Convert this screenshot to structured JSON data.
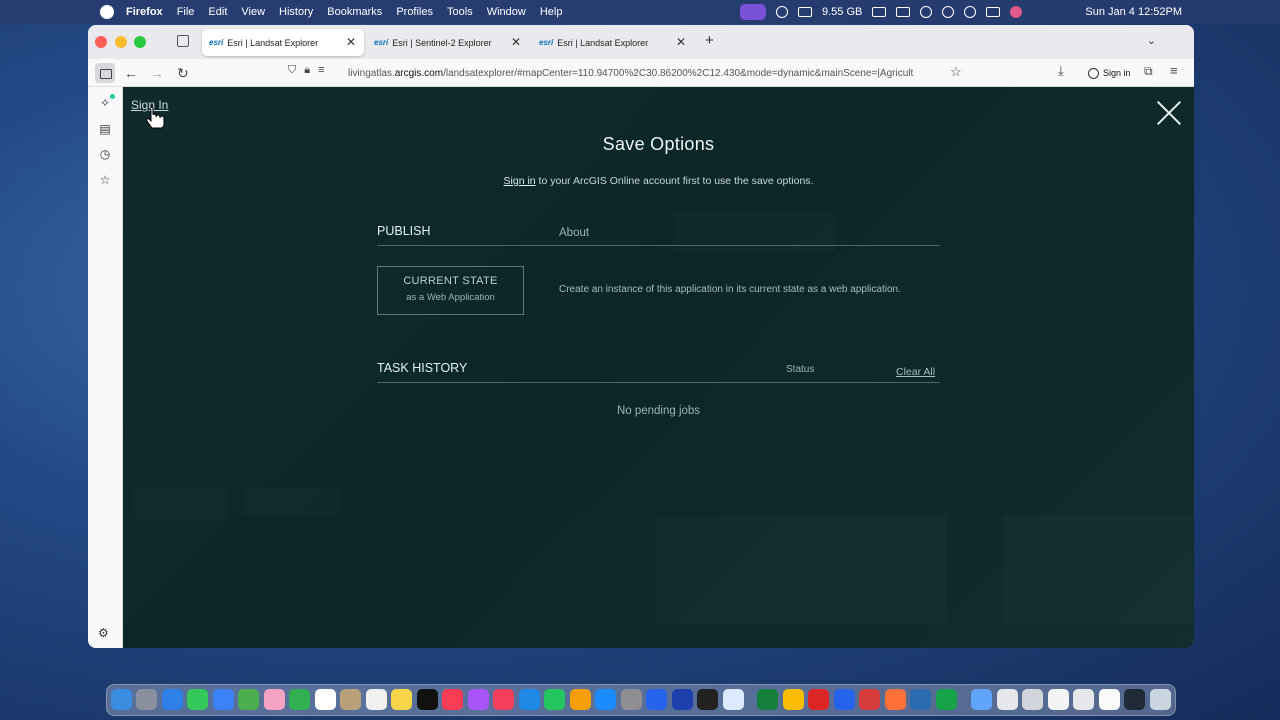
{
  "menubar": {
    "app_name": "Firefox",
    "menus": [
      "File",
      "Edit",
      "View",
      "History",
      "Bookmarks",
      "Profiles",
      "Tools",
      "Window",
      "Help"
    ],
    "memory": "9.55 GB",
    "datetime": "Sun Jan 4  12:52PM"
  },
  "browser": {
    "tabs": [
      {
        "brand": "esri",
        "title": "Esri | Landsat Explorer",
        "active": true
      },
      {
        "brand": "esri",
        "title": "Esri | Sentinel-2 Explorer",
        "active": false
      },
      {
        "brand": "esri",
        "title": "Esri | Landsat Explorer",
        "active": false
      }
    ],
    "url_prefix": "livingatlas.",
    "url_host": "arcgis.com",
    "url_path": "/landsatexplorer/#mapCenter=110.94700%2C30.86200%2C12.430&mode=dynamic&mainScene=|Agricult",
    "signin_label": "Sign in",
    "new_tab_glyph": "+",
    "close_glyph": "✕"
  },
  "page": {
    "signin_link": "Sign In",
    "modal": {
      "title": "Save Options",
      "subtitle_link": "Sign in",
      "subtitle_rest": " to your ArcGIS Online account first to use the save options.",
      "publish_label": "PUBLISH",
      "about_label": "About",
      "current_state_title": "CURRENT STATE",
      "current_state_sub": "as a Web Application",
      "current_state_desc": "Create an instance of this application in its current state as a web application.",
      "task_history_label": "TASK HISTORY",
      "status_label": "Status",
      "clear_all_label": "Clear All",
      "no_jobs": "No pending jobs"
    }
  },
  "colors": {
    "overlay_bg": "#0f2526",
    "accent_tab_brand": "#0a6fb8"
  }
}
